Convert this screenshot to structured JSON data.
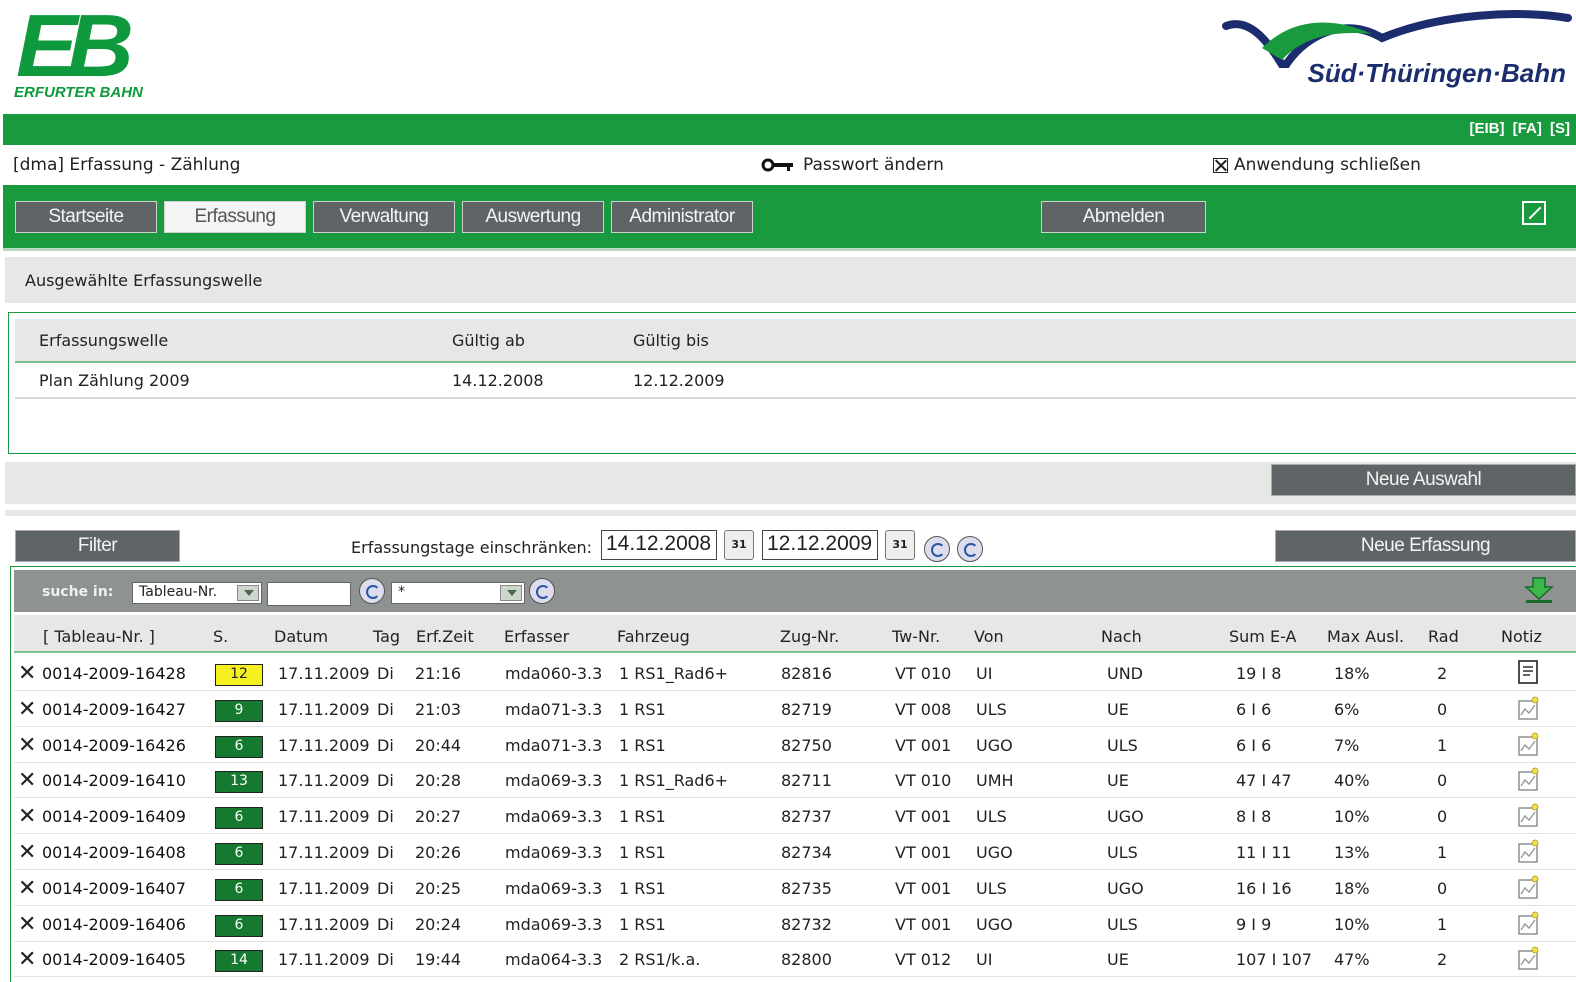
{
  "header": {
    "logo_left_text": "EB",
    "logo_left_brand": "ERFURTER BAHN",
    "logo_right_text": "Süd·Thüringen·Bahn",
    "top_links": "[EIB] [FA] [S]",
    "page_title": "[dma] Erfassung - Zählung",
    "password_link": "Passwort ändern",
    "close_link": "Anwendung schließen"
  },
  "nav": {
    "items": [
      "Startseite",
      "Erfassung",
      "Verwaltung",
      "Auswertung",
      "Administrator"
    ],
    "active": "Erfassung",
    "logout": "Abmelden"
  },
  "wave_section": {
    "heading": "Ausgewählte Erfassungswelle",
    "columns": [
      "Erfassungswelle",
      "Gültig ab",
      "Gültig bis"
    ],
    "row": [
      "Plan Zählung 2009",
      "14.12.2008",
      "12.12.2009"
    ],
    "new_selection": "Neue Auswahl"
  },
  "filter": {
    "button": "Filter",
    "label": "Erfassungstage einschränken:",
    "date_from": "14.12.2008",
    "date_to": "12.12.2009",
    "calendar_label": "31",
    "new_capture": "Neue Erfassung"
  },
  "search": {
    "label": "suche in:",
    "field_select": "Tableau-Nr.",
    "query": "",
    "filter_select": "*"
  },
  "table": {
    "columns": [
      "[ Tableau-Nr. ]",
      "S.",
      "Datum",
      "Tag",
      "Erf.Zeit",
      "Erfasser",
      "Fahrzeug",
      "Zug-Nr.",
      "Tw-Nr.",
      "Von",
      "Nach",
      "Sum E-A",
      "Max Ausl.",
      "Rad",
      "Notiz"
    ],
    "rows": [
      {
        "tab": "0014-2009-16428",
        "s": "12",
        "status": "yellow",
        "datum": "17.11.2009",
        "tag": "Di",
        "zeit": "21:16",
        "erfasser": "mda060-3.3",
        "fahrzeug": "1 RS1_Rad6+",
        "zug": "82816",
        "tw": "VT 010",
        "von": "UI",
        "nach": "UND",
        "sum": "19 I 8",
        "max": "18%",
        "rad": "2",
        "note": "document"
      },
      {
        "tab": "0014-2009-16427",
        "s": "9",
        "status": "green",
        "datum": "17.11.2009",
        "tag": "Di",
        "zeit": "21:03",
        "erfasser": "mda071-3.3",
        "fahrzeug": "1 RS1",
        "zug": "82719",
        "tw": "VT 008",
        "von": "ULS",
        "nach": "UE",
        "sum": "6 I 6",
        "max": "6%",
        "rad": "0",
        "note": "edit"
      },
      {
        "tab": "0014-2009-16426",
        "s": "6",
        "status": "green",
        "datum": "17.11.2009",
        "tag": "Di",
        "zeit": "20:44",
        "erfasser": "mda071-3.3",
        "fahrzeug": "1 RS1",
        "zug": "82750",
        "tw": "VT 001",
        "von": "UGO",
        "nach": "ULS",
        "sum": "6 I 6",
        "max": "7%",
        "rad": "1",
        "note": "edit"
      },
      {
        "tab": "0014-2009-16410",
        "s": "13",
        "status": "green",
        "datum": "17.11.2009",
        "tag": "Di",
        "zeit": "20:28",
        "erfasser": "mda069-3.3",
        "fahrzeug": "1 RS1_Rad6+",
        "zug": "82711",
        "tw": "VT 010",
        "von": "UMH",
        "nach": "UE",
        "sum": "47 I 47",
        "max": "40%",
        "rad": "0",
        "note": "edit"
      },
      {
        "tab": "0014-2009-16409",
        "s": "6",
        "status": "green",
        "datum": "17.11.2009",
        "tag": "Di",
        "zeit": "20:27",
        "erfasser": "mda069-3.3",
        "fahrzeug": "1 RS1",
        "zug": "82737",
        "tw": "VT 001",
        "von": "ULS",
        "nach": "UGO",
        "sum": "8 I 8",
        "max": "10%",
        "rad": "0",
        "note": "edit"
      },
      {
        "tab": "0014-2009-16408",
        "s": "6",
        "status": "green",
        "datum": "17.11.2009",
        "tag": "Di",
        "zeit": "20:26",
        "erfasser": "mda069-3.3",
        "fahrzeug": "1 RS1",
        "zug": "82734",
        "tw": "VT 001",
        "von": "UGO",
        "nach": "ULS",
        "sum": "11 I 11",
        "max": "13%",
        "rad": "1",
        "note": "edit"
      },
      {
        "tab": "0014-2009-16407",
        "s": "6",
        "status": "green",
        "datum": "17.11.2009",
        "tag": "Di",
        "zeit": "20:25",
        "erfasser": "mda069-3.3",
        "fahrzeug": "1 RS1",
        "zug": "82735",
        "tw": "VT 001",
        "von": "ULS",
        "nach": "UGO",
        "sum": "16 I 16",
        "max": "18%",
        "rad": "0",
        "note": "edit"
      },
      {
        "tab": "0014-2009-16406",
        "s": "6",
        "status": "green",
        "datum": "17.11.2009",
        "tag": "Di",
        "zeit": "20:24",
        "erfasser": "mda069-3.3",
        "fahrzeug": "1 RS1",
        "zug": "82732",
        "tw": "VT 001",
        "von": "UGO",
        "nach": "ULS",
        "sum": "9 I 9",
        "max": "10%",
        "rad": "1",
        "note": "edit"
      },
      {
        "tab": "0014-2009-16405",
        "s": "14",
        "status": "green",
        "datum": "17.11.2009",
        "tag": "Di",
        "zeit": "19:44",
        "erfasser": "mda064-3.3",
        "fahrzeug": "2 RS1/k.a.",
        "zug": "82800",
        "tw": "VT 012",
        "von": "UI",
        "nach": "UE",
        "sum": "107 I 107",
        "max": "47%",
        "rad": "2",
        "note": "edit"
      }
    ]
  },
  "colors": {
    "brand_green": "#1a9a3e",
    "button_grey": "#5f6466",
    "badge_green": "#157a2f",
    "badge_yellow": "#f7f020",
    "brand_blue": "#1b2d6e"
  }
}
